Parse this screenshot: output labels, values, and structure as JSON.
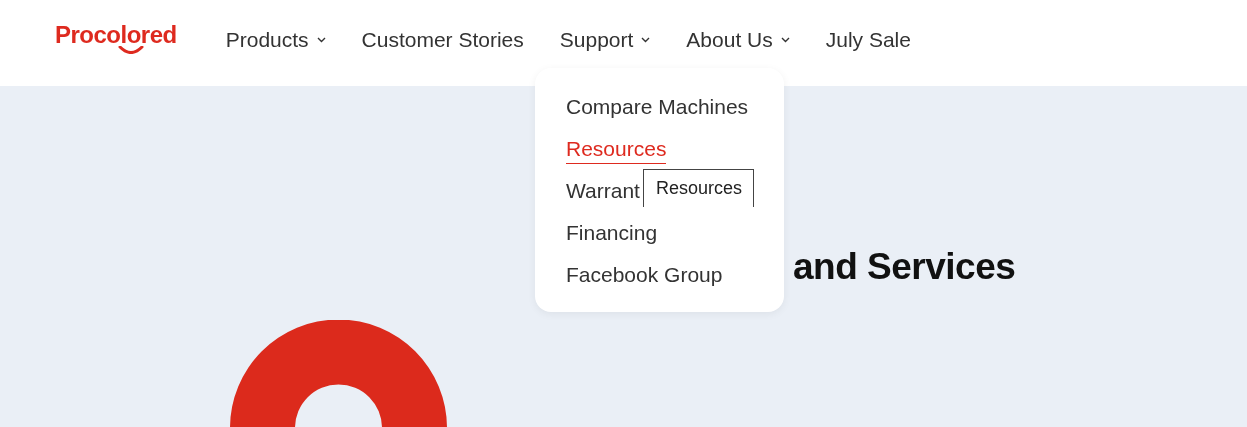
{
  "logo": {
    "text": "Procolored"
  },
  "nav": [
    {
      "label": "Products",
      "dropdown": true
    },
    {
      "label": "Customer Stories",
      "dropdown": false
    },
    {
      "label": "Support",
      "dropdown": true
    },
    {
      "label": "About Us",
      "dropdown": true
    },
    {
      "label": "July Sale",
      "dropdown": false
    }
  ],
  "support_menu": {
    "items": [
      {
        "label": "Compare Machines",
        "selected": false
      },
      {
        "label": "Resources",
        "selected": true
      },
      {
        "label": "Warrant",
        "selected": false
      },
      {
        "label": "Financing",
        "selected": false
      },
      {
        "label": "Facebook Group",
        "selected": false
      }
    ]
  },
  "tooltip": {
    "text": "Resources"
  },
  "heading": "and Services"
}
